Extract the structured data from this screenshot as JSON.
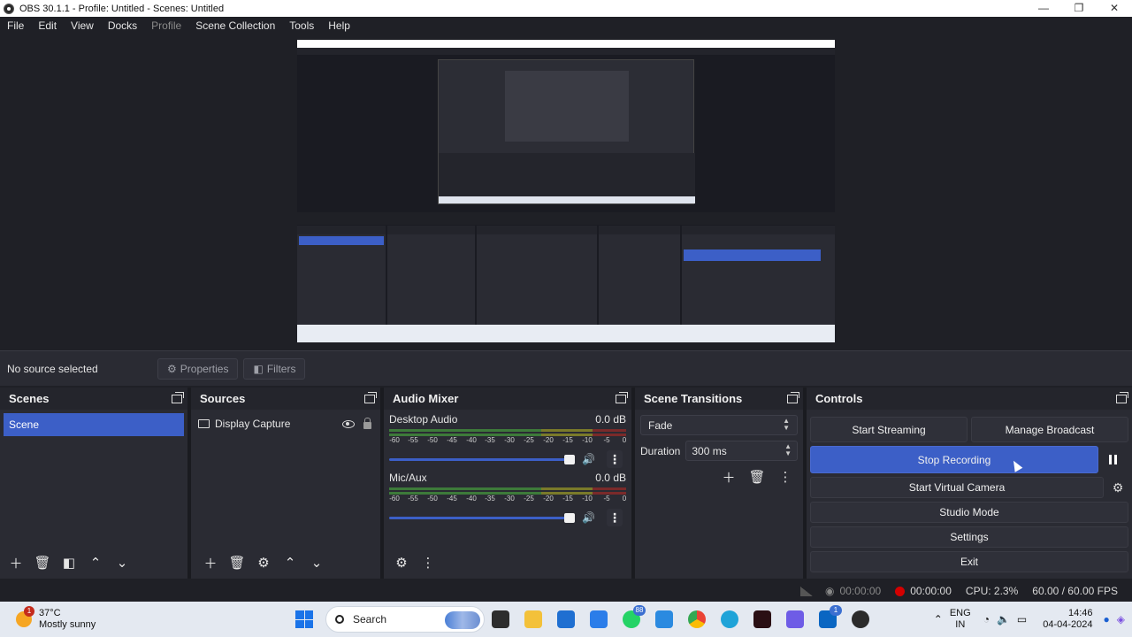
{
  "window": {
    "title": "OBS 30.1.1 - Profile: Untitled - Scenes: Untitled",
    "minimize": "—",
    "maximize": "❐",
    "close": "✕"
  },
  "menu": [
    "File",
    "Edit",
    "View",
    "Docks",
    "Profile",
    "Scene Collection",
    "Tools",
    "Help"
  ],
  "source_toolbar": {
    "no_source": "No source selected",
    "properties": "Properties",
    "filters": "Filters"
  },
  "scenes": {
    "title": "Scenes",
    "items": [
      "Scene"
    ]
  },
  "sources": {
    "title": "Sources",
    "items": [
      "Display Capture"
    ]
  },
  "audio_mixer": {
    "title": "Audio Mixer",
    "ticks": [
      "-60",
      "-55",
      "-50",
      "-45",
      "-40",
      "-35",
      "-30",
      "-25",
      "-20",
      "-15",
      "-10",
      "-5",
      "0"
    ],
    "channels": [
      {
        "name": "Desktop Audio",
        "level": "0.0 dB",
        "volume": 1.0
      },
      {
        "name": "Mic/Aux",
        "level": "0.0 dB",
        "volume": 1.0
      }
    ]
  },
  "scene_transitions": {
    "title": "Scene Transitions",
    "transition": "Fade",
    "duration_label": "Duration",
    "duration_value": "300 ms"
  },
  "controls": {
    "title": "Controls",
    "start_streaming": "Start Streaming",
    "manage_broadcast": "Manage Broadcast",
    "stop_recording": "Stop Recording",
    "start_virtual_camera": "Start Virtual Camera",
    "studio_mode": "Studio Mode",
    "settings": "Settings",
    "exit": "Exit"
  },
  "statusbar": {
    "stream_time": "00:00:00",
    "record_time": "00:00:00",
    "cpu": "CPU: 2.3%",
    "fps": "60.00 / 60.00 FPS"
  },
  "taskbar": {
    "weather_badge": "1",
    "temperature": "37°C",
    "condition": "Mostly sunny",
    "search": "Search",
    "whatsapp_badge": "88",
    "linkedin_badge": "1",
    "lang_top": "ENG",
    "lang_bottom": "IN",
    "time": "14:46",
    "date": "04-04-2024"
  },
  "colors": {
    "accent": "#3c5fc7",
    "record": "#d40000",
    "panel": "#2a2b33",
    "background": "#1f2026"
  }
}
